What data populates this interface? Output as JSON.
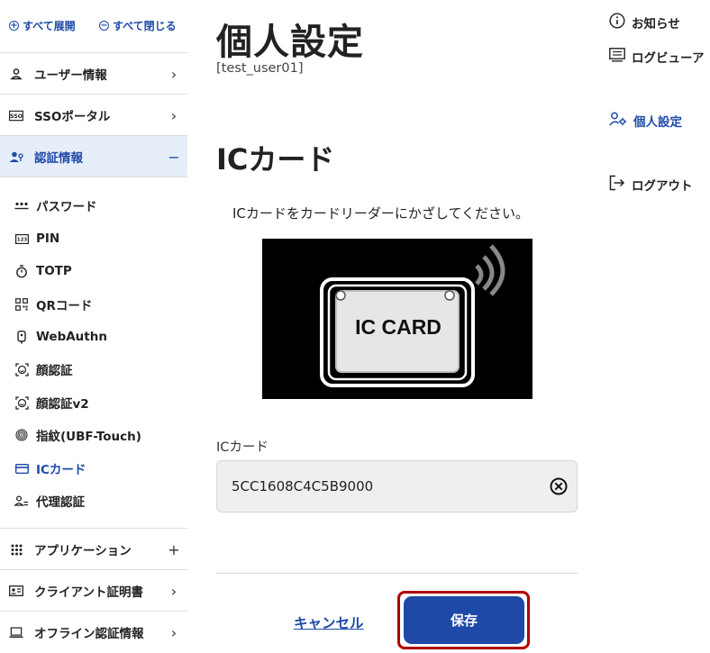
{
  "sidebar": {
    "expand_all": "すべて展開",
    "collapse_all": "すべて閉じる",
    "sections": [
      {
        "label": "ユーザー情報",
        "toggle": "›"
      },
      {
        "label": "SSOポータル",
        "toggle": "›"
      },
      {
        "label": "認証情報",
        "toggle": "−"
      },
      {
        "label": "アプリケーション",
        "toggle": "+"
      },
      {
        "label": "クライアント証明書",
        "toggle": "›"
      },
      {
        "label": "オフライン認証情報",
        "toggle": "›"
      }
    ],
    "auth_items": [
      {
        "label": "パスワード"
      },
      {
        "label": "PIN"
      },
      {
        "label": "TOTP"
      },
      {
        "label": "QRコード"
      },
      {
        "label": "WebAuthn"
      },
      {
        "label": "顔認証"
      },
      {
        "label": "顔認証v2"
      },
      {
        "label": "指紋(UBF-Touch)"
      },
      {
        "label": "ICカード"
      },
      {
        "label": "代理認証"
      }
    ]
  },
  "main": {
    "page_title": "個人設定",
    "username": "[test_user01]",
    "section_title": "ICカード",
    "instruction": "ICカードをカードリーダーにかざしてください。",
    "card_image_text": "IC CARD",
    "field_label": "ICカード",
    "field_value": "5CC1608C4C5B9000",
    "cancel_label": "キャンセル",
    "save_label": "保存"
  },
  "right_nav": {
    "items": [
      {
        "label": "お知らせ"
      },
      {
        "label": "ログビューア"
      },
      {
        "label": "個人設定"
      },
      {
        "label": "ログアウト"
      }
    ]
  },
  "colors": {
    "accent": "#1f4aa8",
    "save_button": "#1e49a6",
    "highlight_border": "#b00000",
    "active_section_bg": "#e6eef9"
  }
}
